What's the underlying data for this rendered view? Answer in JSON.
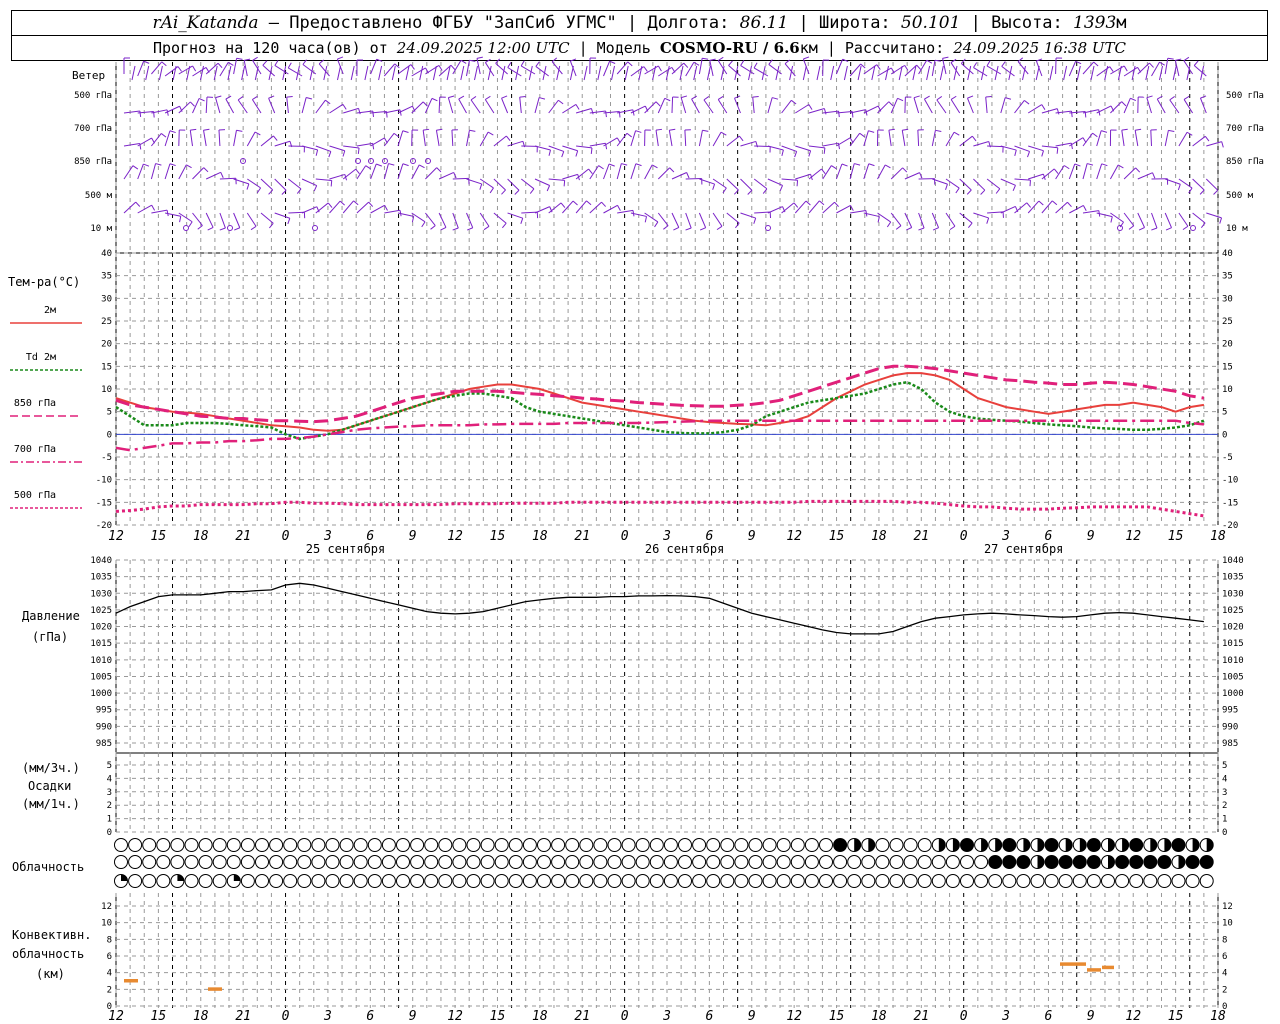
{
  "header": {
    "station": "rAi_Katanda",
    "provider": "— Предоставлено ФГБУ \"ЗапСиб УГМС\" | Долгота:",
    "lon": "86.11",
    "lat_label": "| Широта:",
    "lat": "50.101",
    "alt_label": "| Высота:",
    "alt": "1393",
    "alt_unit": "м",
    "forecast_prefix": "Прогноз на 120 часа(ов) от",
    "forecast_time": "24.09.2025 12:00 UTC",
    "model_label": "| Модель",
    "model": "COSMO-RU / 6.6",
    "model_unit": "км",
    "calc_label": "| Рассчитано:",
    "calc_time": "24.09.2025 16:38 UTC"
  },
  "wind_panel": {
    "title": "Ветер",
    "levels": [
      "500 гПа",
      "700 гПа",
      "850 гПа",
      "500 м",
      "10 м"
    ]
  },
  "temperature_panel": {
    "title": "Тем-ра(°C)",
    "legend": [
      {
        "label": "2м",
        "color": "#e8403c",
        "style": "solid"
      },
      {
        "label": "Td  2м",
        "color": "#1a8a1a",
        "style": "dotted"
      },
      {
        "label": "850 гПа",
        "color": "#e0207a",
        "style": "dashed"
      },
      {
        "label": "700 гПа",
        "color": "#e0207a",
        "style": "dashdot"
      },
      {
        "label": "500 гПа",
        "color": "#e0207a",
        "style": "dotted"
      }
    ]
  },
  "pressure_panel": {
    "title": "Давление",
    "unit": "(гПа)"
  },
  "precip_panel": {
    "unit_top": "(мм/3ч.)",
    "title": "Осадки",
    "unit_bottom": "(мм/1ч.)"
  },
  "cloud_panel": {
    "title": "Облачность"
  },
  "convective_panel": {
    "title_1": "Конвективн.",
    "title_2": "облачность",
    "unit": "(км)"
  },
  "time_axis": {
    "hour_labels": [
      "12",
      "15",
      "18",
      "21",
      "0",
      "3",
      "6",
      "9",
      "12",
      "15",
      "18",
      "21",
      "0",
      "3",
      "6",
      "9",
      "12",
      "15",
      "18",
      "21",
      "0",
      "3",
      "6",
      "9",
      "12",
      "15",
      "18"
    ],
    "day_labels": [
      "25 сентября",
      "26 сентября",
      "27 сентября"
    ]
  },
  "colors": {
    "wind": "#7a22c8",
    "convective": "#e88a30",
    "grid": "#999999"
  },
  "chart_data": [
    {
      "type": "line",
      "title": "Тем-ра(°C)",
      "x_unit": "hours from 24.09.2025 12:00 UTC",
      "x": [
        0,
        3,
        6,
        9,
        12,
        15,
        18,
        21,
        24,
        27,
        30,
        33,
        36,
        39,
        42,
        45,
        48,
        51,
        54,
        57,
        60,
        63,
        66,
        69,
        72,
        75,
        78,
        81,
        84,
        87,
        90,
        93,
        96,
        99,
        102,
        105,
        108,
        111,
        114,
        117,
        120,
        123,
        126,
        129,
        132,
        135,
        138,
        141,
        144,
        147,
        150,
        153,
        156,
        159,
        162,
        165,
        168,
        171,
        174,
        177,
        180,
        183,
        186,
        189,
        192,
        195,
        198,
        201,
        204,
        207,
        210,
        213,
        216,
        219,
        222,
        225,
        228,
        231,
        234
      ],
      "ylim": [
        -20,
        40
      ],
      "y_ticks": [
        -20,
        -15,
        -10,
        -5,
        0,
        5,
        10,
        15,
        20,
        25,
        30,
        35,
        40
      ],
      "series": [
        {
          "name": "2м",
          "values": [
            8,
            7,
            6,
            5.5,
            5,
            4.8,
            4.5,
            4,
            3.5,
            3,
            2.5,
            2,
            1.8,
            1.5,
            1,
            0.8,
            1,
            2,
            3,
            4,
            5,
            6,
            7,
            8,
            9,
            10,
            10.5,
            11,
            11,
            10.5,
            10,
            9,
            8,
            7,
            6.5,
            6,
            5.5,
            5,
            4.5,
            4,
            3.5,
            3,
            2.7,
            2.5,
            2.3,
            2.2,
            2,
            2.5,
            3,
            4,
            6,
            8,
            9.5,
            11,
            12,
            13,
            13.5,
            13.5,
            13,
            12,
            10,
            8,
            7,
            6,
            5.5,
            5,
            4.5,
            5,
            5.5,
            6,
            6.5,
            6.5,
            7,
            6.5,
            6,
            5,
            6,
            6.5
          ]
        },
        {
          "name": "Td 2м",
          "values": [
            6,
            4,
            2,
            2,
            2,
            2.5,
            2.5,
            2.5,
            2.3,
            2,
            1.8,
            1.5,
            0,
            -1,
            -0.5,
            0,
            1,
            2,
            3,
            4,
            5,
            6,
            7,
            8,
            8.5,
            9,
            9,
            8.5,
            8,
            6,
            5,
            4.5,
            4,
            3.5,
            3,
            2.5,
            2,
            1.5,
            1,
            0.5,
            0.3,
            0.2,
            0.2,
            0.5,
            1,
            2,
            4,
            5,
            6,
            7,
            7.5,
            8,
            8.5,
            9,
            10,
            11,
            11.5,
            10,
            7,
            5,
            4,
            3.5,
            3.2,
            3,
            2.8,
            2.5,
            2.2,
            2,
            1.8,
            1.5,
            1.3,
            1.2,
            1,
            1,
            1.2,
            1.5,
            2,
            3
          ]
        },
        {
          "name": "850 гПа",
          "values": [
            7.5,
            6.5,
            6,
            5.5,
            5,
            4.5,
            4,
            3.8,
            3.5,
            3.5,
            3.2,
            3,
            3,
            2.9,
            2.8,
            3,
            3.5,
            4,
            5,
            6,
            7,
            8,
            8.5,
            9,
            9.5,
            9.5,
            9.5,
            9.5,
            9.3,
            9,
            8.8,
            8.5,
            8.3,
            8,
            7.8,
            7.5,
            7.3,
            7,
            6.8,
            6.6,
            6.4,
            6.3,
            6.2,
            6.2,
            6.4,
            6.6,
            7,
            7.5,
            8.5,
            9.5,
            10.5,
            11.5,
            12.5,
            13.5,
            14.5,
            15,
            15,
            14.8,
            14.5,
            14,
            13.5,
            13,
            12.5,
            12,
            11.8,
            11.5,
            11.3,
            11,
            11,
            11.3,
            11.5,
            11.3,
            11,
            10.5,
            10,
            9.5,
            8.5,
            8
          ]
        },
        {
          "name": "700 гПа",
          "values": [
            -3,
            -3.5,
            -3,
            -2.5,
            -2,
            -2,
            -1.8,
            -1.8,
            -1.5,
            -1.5,
            -1.3,
            -1,
            -1,
            -0.8,
            -0.5,
            0,
            0.5,
            1,
            1.3,
            1.5,
            1.7,
            1.8,
            2,
            2,
            2,
            2,
            2.2,
            2.2,
            2.3,
            2.3,
            2.3,
            2.3,
            2.5,
            2.5,
            2.5,
            2.5,
            2.5,
            2.5,
            2.6,
            2.7,
            2.8,
            2.9,
            3,
            3,
            3,
            3,
            3,
            3,
            3,
            3,
            3,
            3,
            3,
            3,
            3,
            3,
            3,
            3,
            3,
            3,
            3,
            3,
            3,
            3,
            3,
            3,
            3,
            3,
            3,
            3,
            3,
            3,
            3,
            3,
            3,
            3,
            2.5,
            2.2
          ]
        },
        {
          "name": "500 гПа",
          "values": [
            -17,
            -16.8,
            -16.5,
            -16,
            -15.8,
            -15.8,
            -15.5,
            -15.5,
            -15.5,
            -15.5,
            -15.3,
            -15.3,
            -15,
            -15,
            -15.2,
            -15.2,
            -15.3,
            -15.5,
            -15.5,
            -15.5,
            -15.5,
            -15.5,
            -15.5,
            -15.5,
            -15.3,
            -15.3,
            -15.3,
            -15.3,
            -15.2,
            -15.2,
            -15.2,
            -15.2,
            -15,
            -15,
            -15,
            -15,
            -15,
            -15,
            -15,
            -15,
            -15,
            -15,
            -15,
            -15,
            -15,
            -15,
            -15,
            -15,
            -15,
            -14.8,
            -14.8,
            -14.8,
            -14.8,
            -14.8,
            -14.8,
            -14.8,
            -15,
            -15,
            -15.2,
            -15.5,
            -15.8,
            -16,
            -16,
            -16.3,
            -16.5,
            -16.5,
            -16.5,
            -16.3,
            -16.2,
            -16,
            -16,
            -16,
            -16,
            -16,
            -16.5,
            -17,
            -17.5,
            -18
          ]
        }
      ]
    },
    {
      "type": "line",
      "title": "Давление",
      "ylabel": "(гПа)",
      "x_unit": "hours from 24.09.2025 12:00 UTC",
      "x": [
        0,
        3,
        6,
        9,
        12,
        15,
        18,
        21,
        24,
        27,
        30,
        33,
        36,
        39,
        42,
        45,
        48,
        51,
        54,
        57,
        60,
        63,
        66,
        69,
        72,
        75,
        78,
        81,
        84,
        87,
        90,
        93,
        96,
        99,
        102,
        105,
        108,
        111,
        114,
        117,
        120,
        123,
        126,
        129,
        132,
        135,
        138,
        141,
        144,
        147,
        150,
        153,
        156,
        159,
        162,
        165,
        168,
        171,
        174,
        177,
        180,
        183,
        186,
        189,
        192,
        195,
        198,
        201,
        204,
        207,
        210,
        213,
        216,
        219,
        222,
        225,
        228,
        231,
        234
      ],
      "ylim": [
        985,
        1040
      ],
      "y_ticks": [
        985,
        990,
        995,
        1000,
        1005,
        1010,
        1015,
        1020,
        1025,
        1030,
        1035,
        1040
      ],
      "series": [
        {
          "name": "",
          "values": [
            1024,
            1026,
            1027.5,
            1029,
            1029.5,
            1029.5,
            1029.5,
            1030,
            1030.5,
            1030.5,
            1030.8,
            1031,
            1032.5,
            1033,
            1032.5,
            1031.5,
            1030.5,
            1029.5,
            1028.5,
            1027.5,
            1026.5,
            1025.5,
            1024.5,
            1024,
            1023.8,
            1024,
            1024.5,
            1025.5,
            1026.5,
            1027.5,
            1028,
            1028.5,
            1028.8,
            1028.8,
            1028.8,
            1029,
            1029,
            1029.2,
            1029.2,
            1029.3,
            1029.2,
            1029,
            1028.5,
            1027,
            1025.5,
            1024,
            1023,
            1022,
            1021,
            1020,
            1019,
            1018.2,
            1017.8,
            1017.8,
            1017.8,
            1018.5,
            1020,
            1021.5,
            1022.5,
            1023,
            1023.5,
            1023.8,
            1024,
            1023.8,
            1023.5,
            1023.3,
            1023,
            1022.8,
            1023,
            1023.5,
            1024,
            1024.2,
            1024,
            1023.5,
            1023,
            1022.5,
            1022,
            1021.5
          ]
        }
      ]
    }
  ]
}
